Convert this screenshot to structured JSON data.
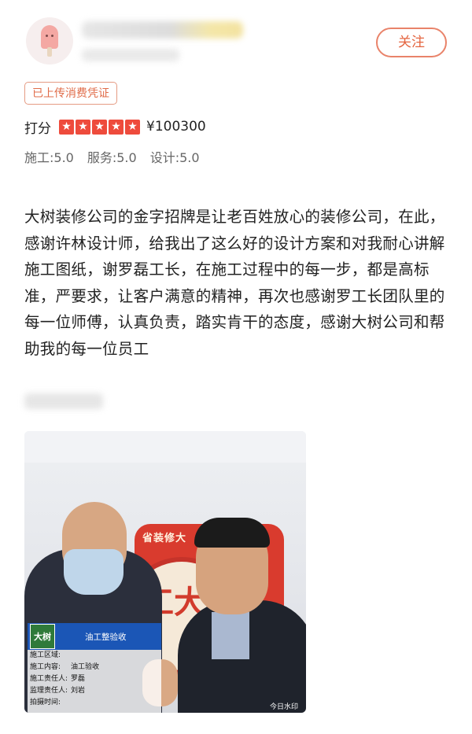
{
  "header": {
    "user_name": "■■■■■■■■",
    "post_time": "■■■■■ ■■■",
    "follow_label": "关注"
  },
  "badge": {
    "label": "已上传消费凭证"
  },
  "rating": {
    "label": "打分",
    "stars": 5,
    "price": "¥100300"
  },
  "scores": [
    {
      "label": "施工:5.0"
    },
    {
      "label": "服务:5.0"
    },
    {
      "label": "设计:5.0"
    }
  ],
  "review": {
    "text": "大树装修公司的金字招牌是让老百姓放心的装修公司，在此，感谢许林设计师，给我出了这么好的设计方案和对我耐心讲解施工图纸，谢罗磊工长，在施工过程中的每一步，都是高标准，严要求，让客户满意的精神，再次也感谢罗工长团队里的每一位师傅，认真负责，踏实肯干的态度，感谢大树公司和帮助我的每一位员工",
    "tag": "■■ ■■■"
  },
  "photo": {
    "banner_text": "省装修大",
    "banner_big": "工大",
    "card": {
      "logo": "大树",
      "title": "油工整验收",
      "rows": [
        {
          "k": "施工区域:",
          "v": ""
        },
        {
          "k": "施工内容:",
          "v": "油工验收"
        },
        {
          "k": "施工责任人:",
          "v": "罗磊"
        },
        {
          "k": "监理责任人:",
          "v": "刘岩"
        },
        {
          "k": "拍摄时间:",
          "v": ""
        }
      ]
    },
    "watermark": "今日水印"
  },
  "colors": {
    "accent": "#e4643f",
    "star": "#ee4b3c",
    "card_header": "#1b56b6"
  }
}
